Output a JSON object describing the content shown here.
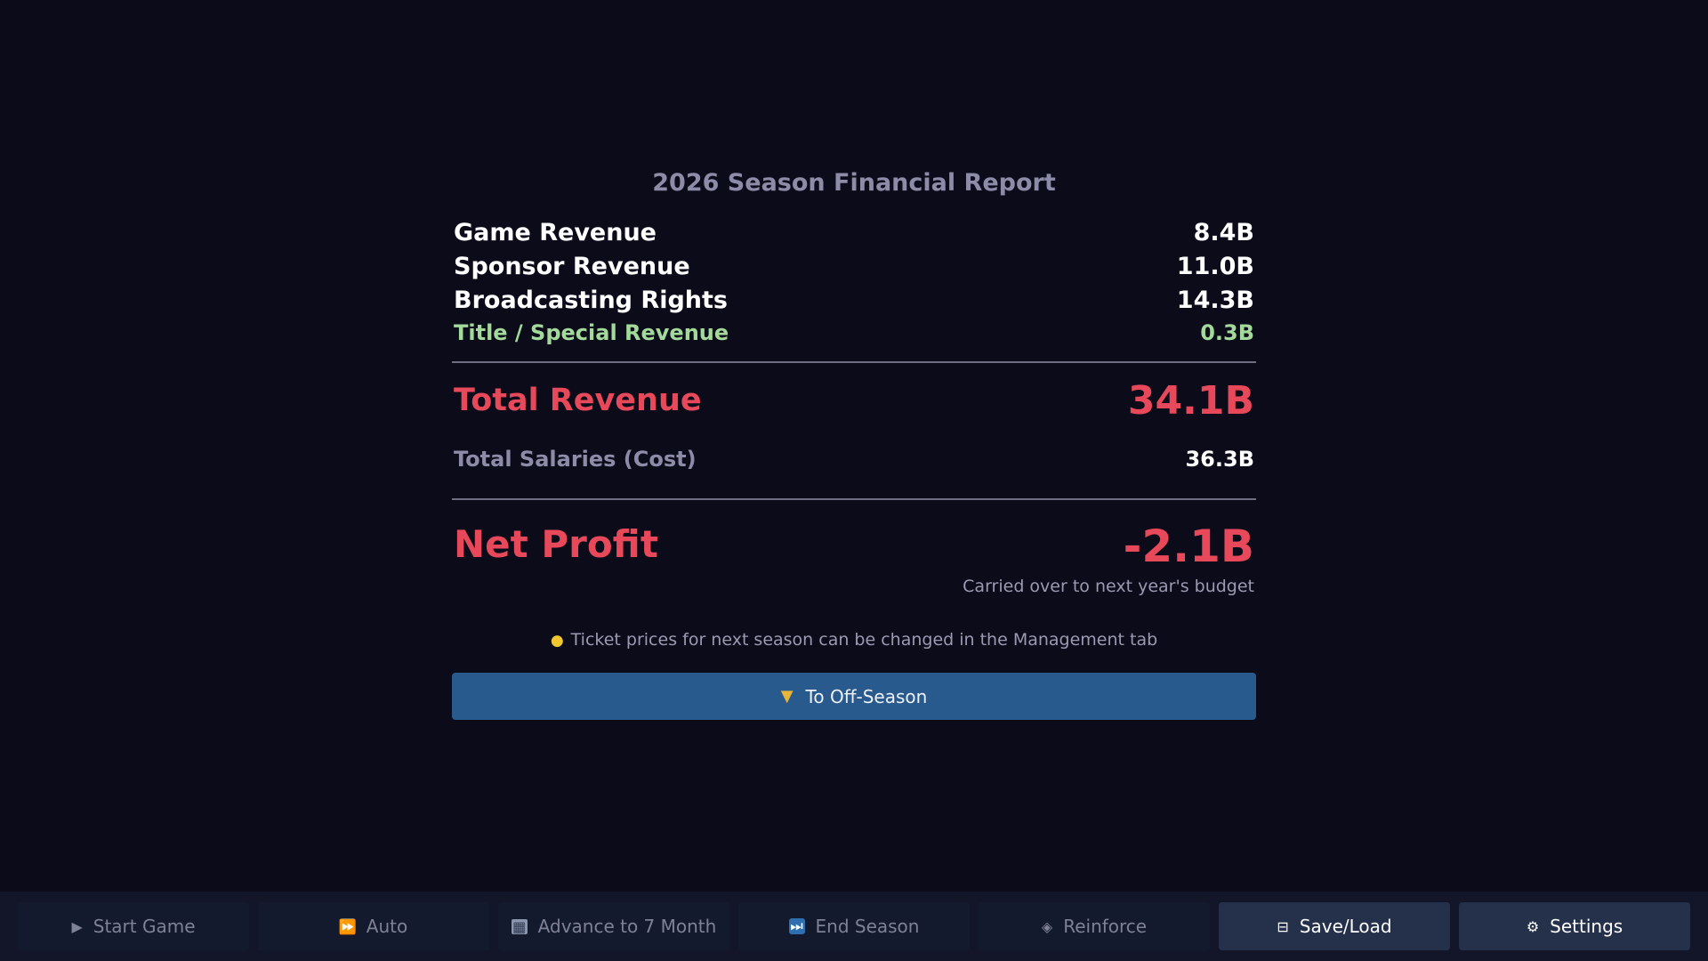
{
  "report": {
    "title": "2026 Season Financial Report",
    "revenues": [
      {
        "label": "Game Revenue",
        "value": "8.4B"
      },
      {
        "label": "Sponsor Revenue",
        "value": "11.0B"
      },
      {
        "label": "Broadcasting Rights",
        "value": "14.3B"
      }
    ],
    "special_revenue": {
      "label": "Title / Special Revenue",
      "value": "0.3B"
    },
    "total_revenue": {
      "label": "Total Revenue",
      "value": "34.1B"
    },
    "total_salaries": {
      "label": "Total Salaries (Cost)",
      "value": "36.3B"
    },
    "net_profit": {
      "label": "Net Profit",
      "value": "-2.1B",
      "note": "Carried over to next year's budget"
    },
    "hint": "Ticket prices for next season can be changed in the Management tab",
    "primary_button": "To Off-Season"
  },
  "bottom_bar": [
    {
      "label": "Start Game",
      "icon": "play-icon",
      "active": false
    },
    {
      "label": "Auto",
      "icon": "fast-forward-icon",
      "active": false
    },
    {
      "label": "Advance to 7 Month",
      "icon": "calendar-icon",
      "active": false
    },
    {
      "label": "End Season",
      "icon": "skip-forward-icon",
      "active": false
    },
    {
      "label": "Reinforce",
      "icon": "diamond-icon",
      "active": false
    },
    {
      "label": "Save/Load",
      "icon": "save-icon",
      "active": true
    },
    {
      "label": "Settings",
      "icon": "gear-icon",
      "active": true
    }
  ],
  "colors": {
    "background": "#0b0b1a",
    "accent_red": "#e8495a",
    "accent_green": "#a3d99a",
    "primary_button": "#285a8e",
    "bottom_bar": "#131629"
  }
}
